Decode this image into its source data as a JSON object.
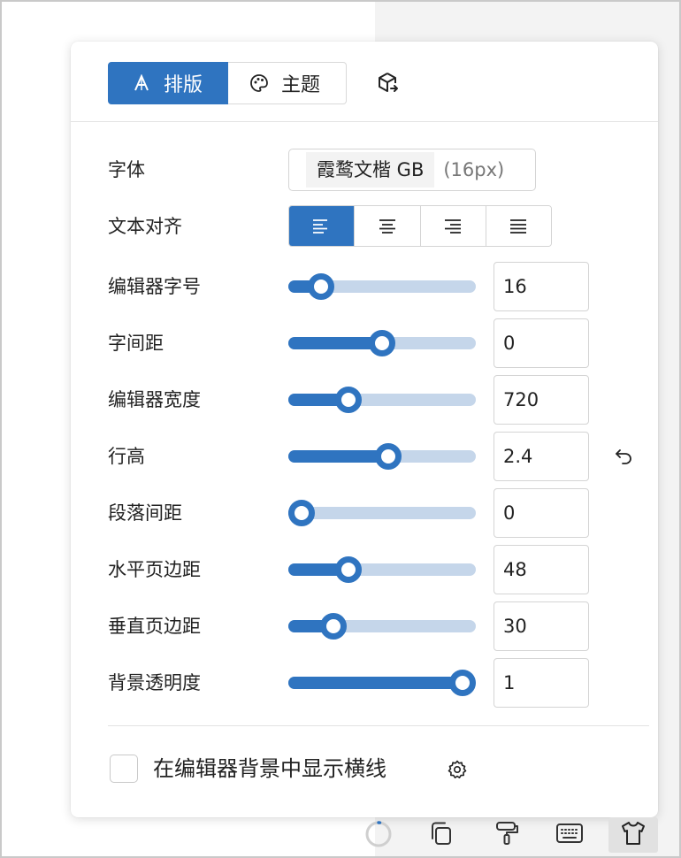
{
  "tabs": {
    "layout_label": "排版",
    "theme_label": "主题"
  },
  "font": {
    "label": "字体",
    "name": "霞鹜文楷 GB",
    "size_hint": "(16px)"
  },
  "align": {
    "label": "文本对齐",
    "options": [
      "left",
      "center",
      "right",
      "justify"
    ],
    "selected": "left"
  },
  "settings": [
    {
      "label": "编辑器字号",
      "value": "16",
      "fraction": 0.12
    },
    {
      "label": "字间距",
      "value": "0",
      "fraction": 0.5
    },
    {
      "label": "编辑器宽度",
      "value": "720",
      "fraction": 0.29
    },
    {
      "label": "行高",
      "value": "2.4",
      "fraction": 0.54
    },
    {
      "label": "段落间距",
      "value": "0",
      "fraction": 0.0
    },
    {
      "label": "水平页边距",
      "value": "48",
      "fraction": 0.29
    },
    {
      "label": "垂直页边距",
      "value": "30",
      "fraction": 0.2
    },
    {
      "label": "背景透明度",
      "value": "1",
      "fraction": 1.0
    }
  ],
  "reset_icon": "undo-icon",
  "checkbox": {
    "label": "在编辑器背景中显示横线",
    "checked": false
  },
  "toolbar": {
    "icons": [
      "loading-spinner-icon",
      "copy-icon",
      "paint-roller-icon",
      "keyboard-icon",
      "tshirt-icon"
    ],
    "active": "tshirt-icon"
  },
  "colors": {
    "accent": "#2f74c0",
    "track": "#c5d6ea"
  }
}
